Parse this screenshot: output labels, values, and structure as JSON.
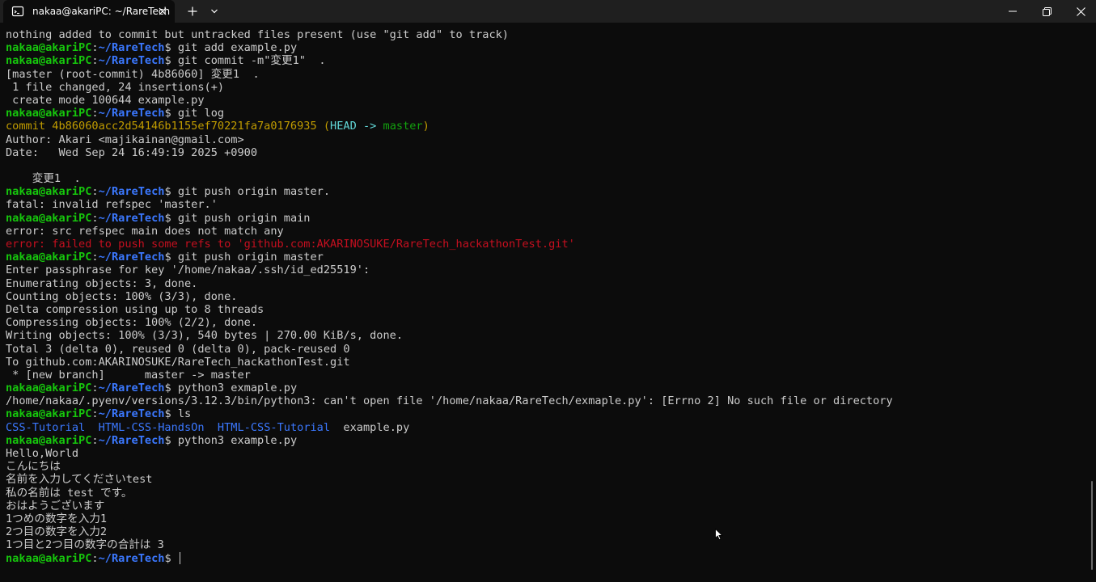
{
  "window": {
    "tab_title": "nakaa@akariPC: ~/RareTech"
  },
  "prompt": {
    "user": "nakaa@akariPC",
    "sep": ":",
    "path": "~/RareTech",
    "dollar": "$ "
  },
  "lines": [
    {
      "segments": [
        {
          "t": "nothing added to commit but untracked files present (use \"git add\" to track)",
          "c": "w"
        }
      ]
    },
    {
      "prompt": true,
      "cmd": "git add example.py"
    },
    {
      "prompt": true,
      "cmd": "git commit -m\"変更1\"  ."
    },
    {
      "segments": [
        {
          "t": "[master (root-commit) 4b86060] 変更1  .",
          "c": "w"
        }
      ]
    },
    {
      "segments": [
        {
          "t": " 1 file changed, 24 insertions(+)",
          "c": "w"
        }
      ]
    },
    {
      "segments": [
        {
          "t": " create mode 100644 example.py",
          "c": "w"
        }
      ]
    },
    {
      "prompt": true,
      "cmd": "git log"
    },
    {
      "segments": [
        {
          "t": "commit 4b86060acc2d54146b1155ef70221fa7a0176935 ",
          "c": "y"
        },
        {
          "t": "(",
          "c": "y"
        },
        {
          "t": "HEAD -> ",
          "c": "c"
        },
        {
          "t": "master",
          "c": "g"
        },
        {
          "t": ")",
          "c": "y"
        }
      ]
    },
    {
      "segments": [
        {
          "t": "Author: Akari <majikainan@gmail.com>",
          "c": "w"
        }
      ]
    },
    {
      "segments": [
        {
          "t": "Date:   Wed Sep 24 16:49:19 2025 +0900",
          "c": "w"
        }
      ]
    },
    {
      "segments": [
        {
          "t": "",
          "c": "w"
        }
      ]
    },
    {
      "segments": [
        {
          "t": "    変更1  .",
          "c": "w"
        }
      ]
    },
    {
      "prompt": true,
      "cmd": "git push origin master."
    },
    {
      "segments": [
        {
          "t": "fatal: invalid refspec 'master.'",
          "c": "w"
        }
      ]
    },
    {
      "prompt": true,
      "cmd": "git push origin main"
    },
    {
      "segments": [
        {
          "t": "error: src refspec main does not match any",
          "c": "w"
        }
      ]
    },
    {
      "segments": [
        {
          "t": "error: failed to push some refs to 'github.com:AKARINOSUKE/RareTech_hackathonTest.git'",
          "c": "r"
        }
      ]
    },
    {
      "prompt": true,
      "cmd": "git push origin master"
    },
    {
      "segments": [
        {
          "t": "Enter passphrase for key '/home/nakaa/.ssh/id_ed25519':",
          "c": "w"
        }
      ]
    },
    {
      "segments": [
        {
          "t": "Enumerating objects: 3, done.",
          "c": "w"
        }
      ]
    },
    {
      "segments": [
        {
          "t": "Counting objects: 100% (3/3), done.",
          "c": "w"
        }
      ]
    },
    {
      "segments": [
        {
          "t": "Delta compression using up to 8 threads",
          "c": "w"
        }
      ]
    },
    {
      "segments": [
        {
          "t": "Compressing objects: 100% (2/2), done.",
          "c": "w"
        }
      ]
    },
    {
      "segments": [
        {
          "t": "Writing objects: 100% (3/3), 540 bytes | 270.00 KiB/s, done.",
          "c": "w"
        }
      ]
    },
    {
      "segments": [
        {
          "t": "Total 3 (delta 0), reused 0 (delta 0), pack-reused 0",
          "c": "w"
        }
      ]
    },
    {
      "segments": [
        {
          "t": "To github.com:AKARINOSUKE/RareTech_hackathonTest.git",
          "c": "w"
        }
      ]
    },
    {
      "segments": [
        {
          "t": " * [new branch]      master -> master",
          "c": "w"
        }
      ]
    },
    {
      "prompt": true,
      "cmd": "python3 exmaple.py"
    },
    {
      "segments": [
        {
          "t": "/home/nakaa/.pyenv/versions/3.12.3/bin/python3: can't open file '/home/nakaa/RareTech/exmaple.py': [Errno 2] No such file or directory",
          "c": "w"
        }
      ]
    },
    {
      "prompt": true,
      "cmd": "ls"
    },
    {
      "segments": [
        {
          "t": "CSS-Tutorial",
          "c": "d"
        },
        {
          "t": "  ",
          "c": "w"
        },
        {
          "t": "HTML-CSS-HandsOn",
          "c": "d"
        },
        {
          "t": "  ",
          "c": "w"
        },
        {
          "t": "HTML-CSS-Tutorial",
          "c": "d"
        },
        {
          "t": "  example.py",
          "c": "w"
        }
      ]
    },
    {
      "prompt": true,
      "cmd": "python3 example.py"
    },
    {
      "segments": [
        {
          "t": "Hello,World",
          "c": "w"
        }
      ]
    },
    {
      "segments": [
        {
          "t": "こんにちは",
          "c": "w"
        }
      ]
    },
    {
      "segments": [
        {
          "t": "名前を入力してくださいtest",
          "c": "w"
        }
      ]
    },
    {
      "segments": [
        {
          "t": "私の名前は test です。",
          "c": "w"
        }
      ]
    },
    {
      "segments": [
        {
          "t": "おはようございます",
          "c": "w"
        }
      ]
    },
    {
      "segments": [
        {
          "t": "1つめの数字を入力1",
          "c": "w"
        }
      ]
    },
    {
      "segments": [
        {
          "t": "2つ目の数字を入力2",
          "c": "w"
        }
      ]
    },
    {
      "segments": [
        {
          "t": "1つ目と2つ目の数字の合計は 3",
          "c": "w"
        }
      ]
    },
    {
      "prompt": true,
      "cmd": "",
      "cursor": true
    }
  ]
}
